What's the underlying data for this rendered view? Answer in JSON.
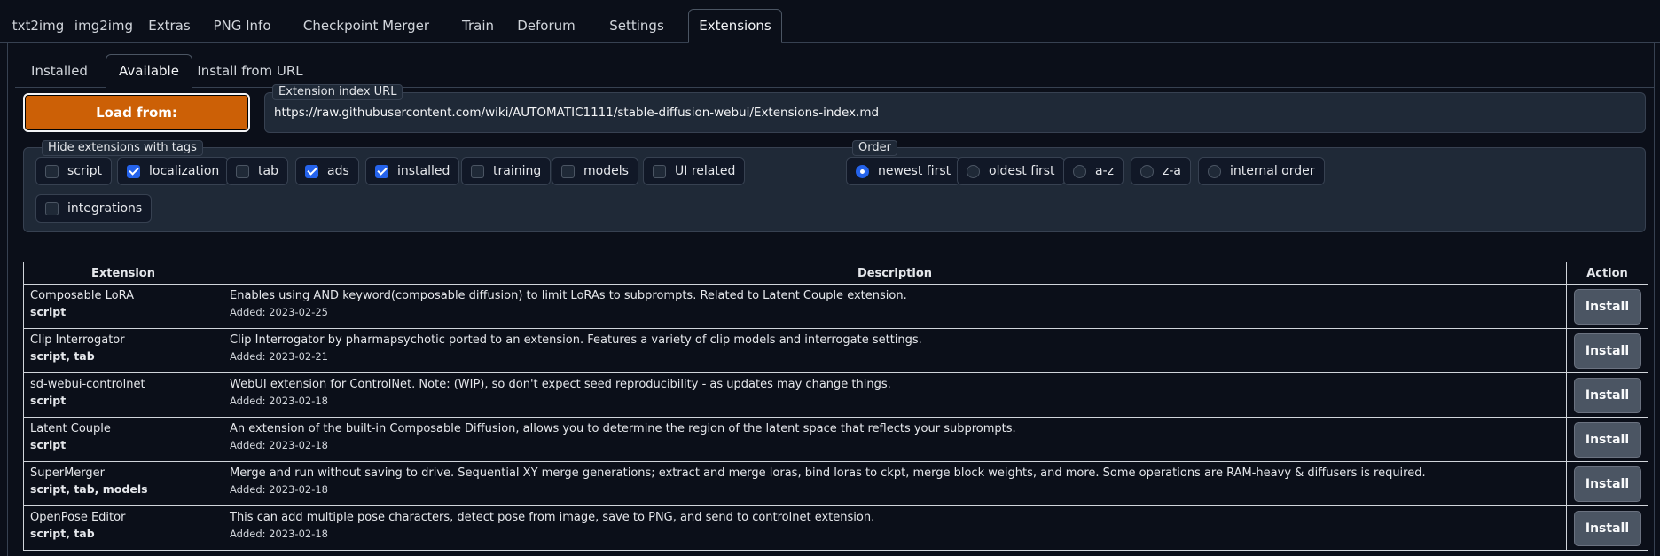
{
  "top_tabs": [
    "txt2img",
    "img2img",
    "Extras",
    "PNG Info",
    "Checkpoint Merger",
    "Train",
    "Deforum",
    "Settings",
    "Extensions"
  ],
  "active_top_tab": "Extensions",
  "sub_tabs": [
    "Installed",
    "Available",
    "Install from URL"
  ],
  "active_sub_tab": "Available",
  "load_button": "Load from:",
  "index_url": {
    "label": "Extension index URL",
    "value": "https://raw.githubusercontent.com/wiki/AUTOMATIC1111/stable-diffusion-webui/Extensions-index.md"
  },
  "hide_tags": {
    "label": "Hide extensions with tags",
    "options": [
      {
        "label": "script",
        "checked": false
      },
      {
        "label": "localization",
        "checked": true
      },
      {
        "label": "tab",
        "checked": false
      },
      {
        "label": "ads",
        "checked": true
      },
      {
        "label": "installed",
        "checked": true
      },
      {
        "label": "training",
        "checked": false
      },
      {
        "label": "models",
        "checked": false
      },
      {
        "label": "UI related",
        "checked": false
      },
      {
        "label": "integrations",
        "checked": false
      }
    ]
  },
  "order": {
    "label": "Order",
    "options": [
      {
        "label": "newest first",
        "selected": true
      },
      {
        "label": "oldest first",
        "selected": false
      },
      {
        "label": "a-z",
        "selected": false
      },
      {
        "label": "z-a",
        "selected": false
      },
      {
        "label": "internal order",
        "selected": false
      }
    ]
  },
  "table": {
    "headers": [
      "Extension",
      "Description",
      "Action"
    ],
    "action_label": "Install",
    "rows": [
      {
        "name": "Composable LoRA",
        "tags": "script",
        "description": "Enables using AND keyword(composable diffusion) to limit LoRAs to subprompts. Related to Latent Couple extension.",
        "added": "Added: 2023-02-25"
      },
      {
        "name": "Clip Interrogator",
        "tags": "script, tab",
        "description": "Clip Interrogator by pharmapsychotic ported to an extension. Features a variety of clip models and interrogate settings.",
        "added": "Added: 2023-02-21"
      },
      {
        "name": "sd-webui-controlnet",
        "tags": "script",
        "description": "WebUI extension for ControlNet. Note: (WIP), so don't expect seed reproducibility - as updates may change things.",
        "added": "Added: 2023-02-18"
      },
      {
        "name": "Latent Couple",
        "tags": "script",
        "description": "An extension of the built-in Composable Diffusion, allows you to determine the region of the latent space that reflects your subprompts.",
        "added": "Added: 2023-02-18"
      },
      {
        "name": "SuperMerger",
        "tags": "script, tab, models",
        "description": "Merge and run without saving to drive. Sequential XY merge generations; extract and merge loras, bind loras to ckpt, merge block weights, and more. Some operations are RAM-heavy & diffusers is required.",
        "added": "Added: 2023-02-18"
      },
      {
        "name": "OpenPose Editor",
        "tags": "script, tab",
        "description": "This can add multiple pose characters, detect pose from image, save to PNG, and send to controlnet extension.",
        "added": "Added: 2023-02-18"
      }
    ]
  }
}
